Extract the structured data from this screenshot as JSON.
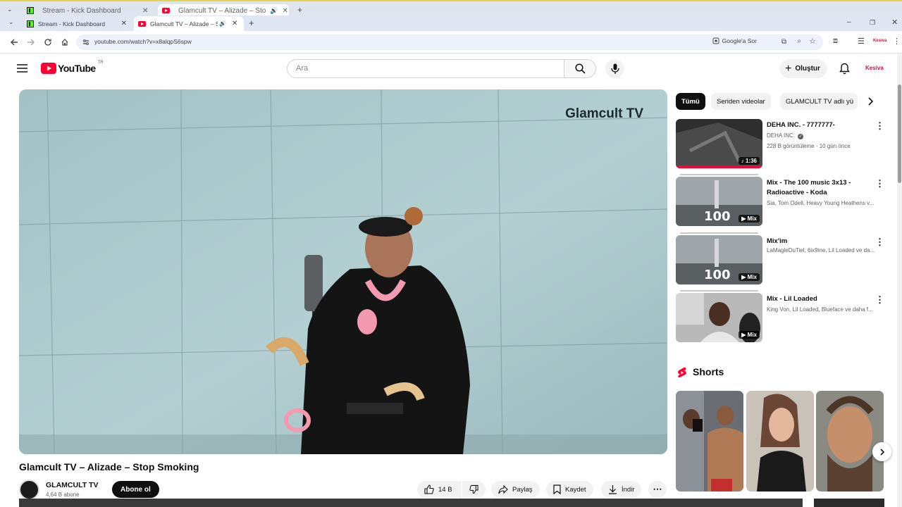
{
  "browser": {
    "outer_tabs": [
      {
        "title": "Stream - Kick Dashboard"
      },
      {
        "title": "Glamcult TV – Alizade – Sto"
      }
    ],
    "tabs": [
      {
        "title": "Stream - Kick Dashboard",
        "favicon": "kick-icon"
      },
      {
        "title": "Glamcult TV – Alizade – Sto",
        "favicon": "youtube-icon",
        "active": true,
        "audio": true
      }
    ],
    "url": "youtube.com/watch?v=x8alqpS6spw",
    "ask_google_label": "Google'a Sor"
  },
  "youtube": {
    "logo_text": "YouTube",
    "region_code": "TR",
    "search_placeholder": "Ara",
    "create_label": "Oluştur",
    "account_label": "Kesiva"
  },
  "player": {
    "watermark": "Glamcult TV"
  },
  "video": {
    "title": "Glamcult TV – Alizade – Stop Smoking",
    "channel_name": "GLAMCULT TV",
    "subscriber_count": "4,64 B abone",
    "subscribe_label": "Abone ol",
    "like_count": "14 B",
    "share_label": "Paylaş",
    "save_label": "Kaydet",
    "download_label": "İndir"
  },
  "chips": [
    "Tümü",
    "Seriden videolar",
    "GLAMCULT TV adlı yü"
  ],
  "recommendations": [
    {
      "title": "DEHA INC. - 7777777-",
      "channel": "DEHA INC.",
      "meta": "228 B görüntüleme · 10 gün önce",
      "badge": "1:36"
    },
    {
      "title": "Mix - The 100 music 3x13 - Radioactive - Koda",
      "channel": "Sia, Tom Odell, Heavy Young Heathens v...",
      "meta": "",
      "badge": "Mix"
    },
    {
      "title": "Mix'im",
      "channel": "LaMagleDuTiel, 6ix9ine, Lil Loaded ve da...",
      "meta": "",
      "badge": "Mix"
    },
    {
      "title": "Mix - Lil Loaded",
      "channel": "King Von, Lil Loaded, Blueface ve daha f...",
      "meta": "",
      "badge": "Mix"
    }
  ],
  "shorts": {
    "heading": "Shorts"
  },
  "colors": {
    "youtube_red": "#ff0033",
    "kick_green": "#53fc18",
    "account_red": "#e10d3c"
  }
}
